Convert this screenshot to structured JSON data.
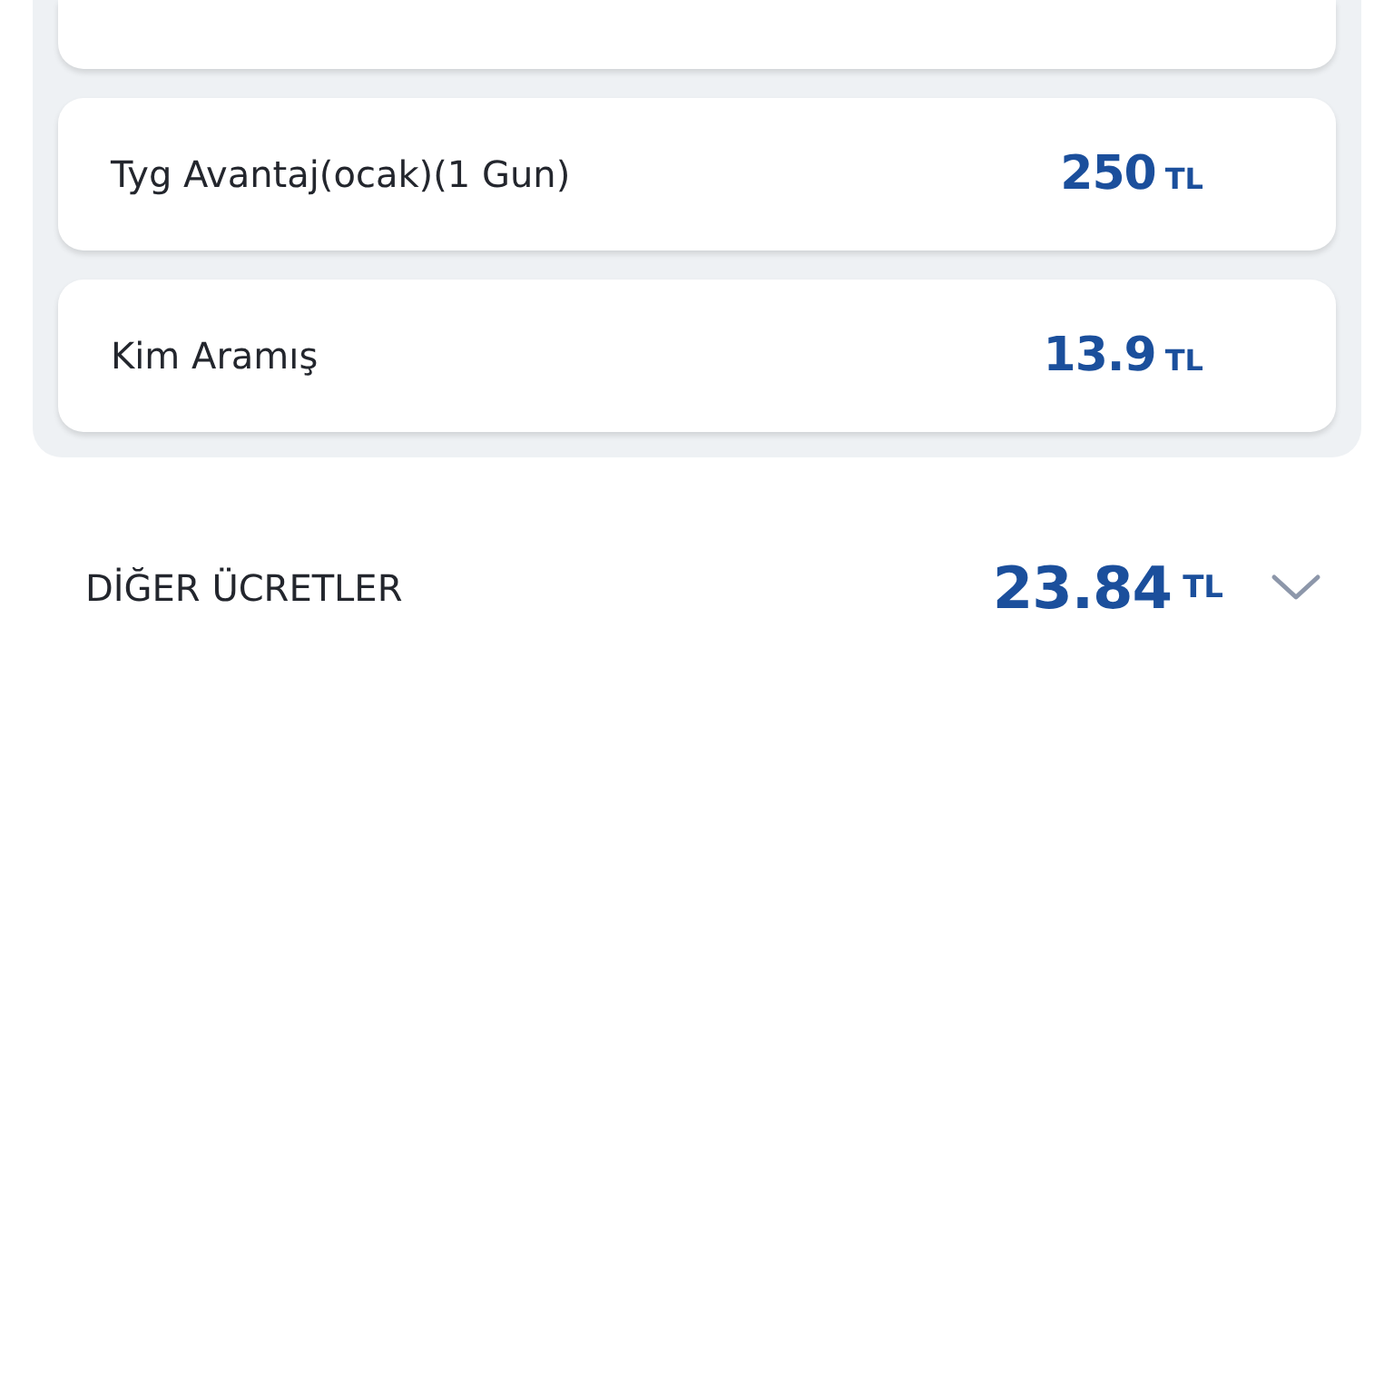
{
  "items": [
    {
      "name": "Tyg Avantaj(ocak)(1 Gun)",
      "amount": "250",
      "currency": "TL"
    },
    {
      "name": "Kim Aramış",
      "amount": "13.9",
      "currency": "TL"
    }
  ],
  "other_fees": {
    "label": "DİĞER ÜCRETLER",
    "amount": "23.84",
    "currency": "TL",
    "expanded": false
  }
}
